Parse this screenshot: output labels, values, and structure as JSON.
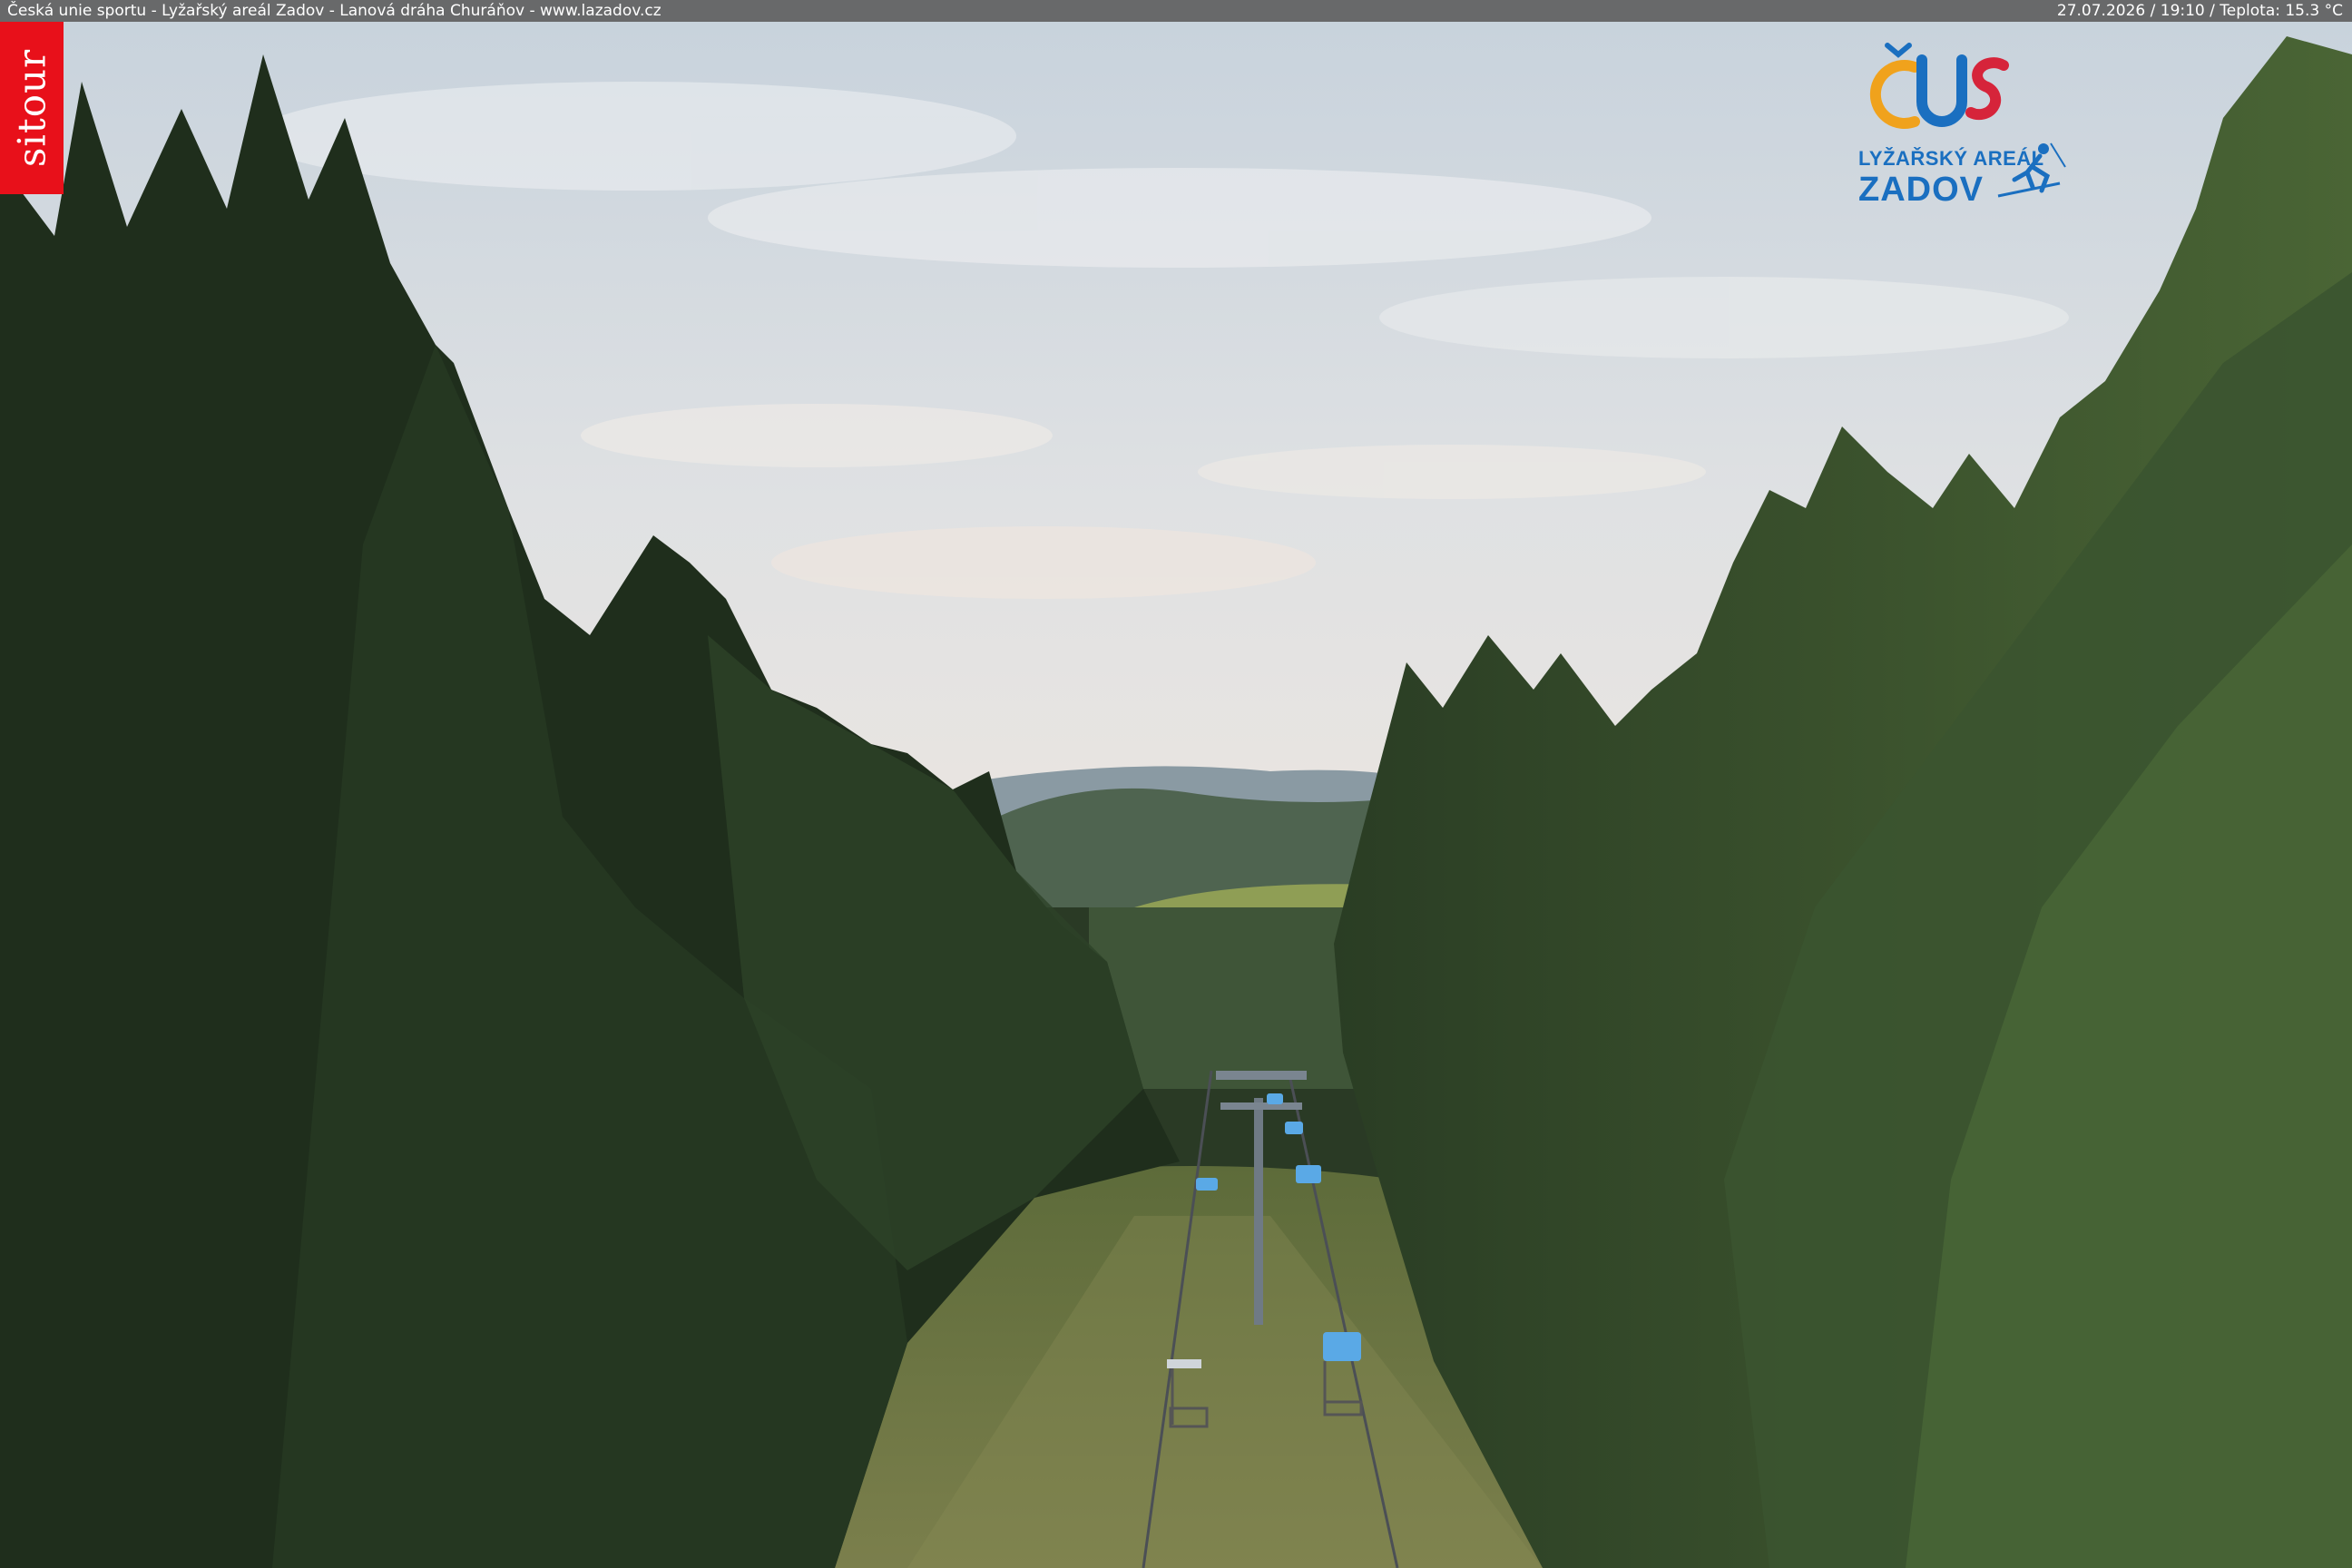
{
  "caption": {
    "left": "Česká unie sportu - Lyžařský areál Zadov - Lanová dráha Churáňov - www.lazadov.cz",
    "right": "27.07.2026 / 19:10 / Teplota: 15.3 °C"
  },
  "watermark": {
    "sitour": "sitour"
  },
  "logo": {
    "mark": "ČUS",
    "line1": "LYŽAŘSKÝ AREÁL",
    "line2": "ZADOV"
  },
  "colors": {
    "sky_top": "#c9d3dd",
    "sky_bottom": "#e6e2de",
    "forest_dark": "#1f2e1c",
    "forest_mid": "#2f4428",
    "forest_lit": "#4d6a35",
    "meadow": "#6e7e3e",
    "chair": "#5aa9e6",
    "sitour_red": "#e8101a",
    "logo_blue": "#1a6fc0",
    "logo_gold": "#f0a21c",
    "logo_red": "#d6243a"
  }
}
